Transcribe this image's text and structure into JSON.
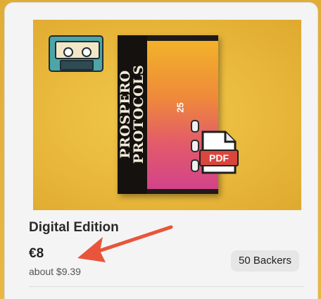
{
  "product": {
    "book_title_line1": "PROSPERO",
    "book_title_line2": "PROTOCOLS",
    "book_number": "25",
    "pdf_label": "PDF",
    "title": "Digital Edition",
    "price": "€8",
    "converted_price": "about $9.39",
    "backers": "50 Backers"
  },
  "colors": {
    "arrow": "#e8553a",
    "pdf_badge": "#d9463c",
    "cassette": "#4da5a8"
  }
}
